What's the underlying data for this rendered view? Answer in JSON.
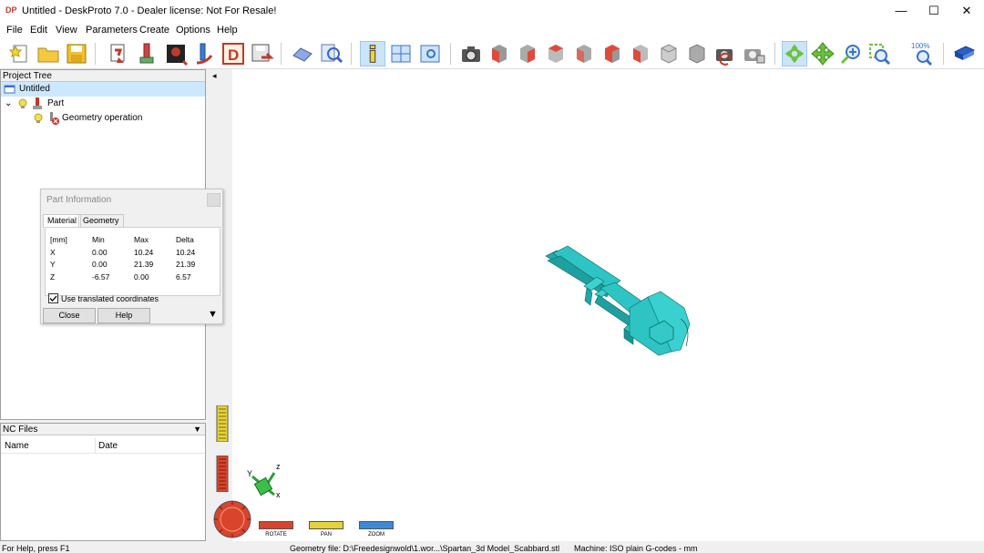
{
  "window": {
    "title": "Untitled - DeskProto 7.0 - Dealer license: Not For Resale!",
    "app_icon_text": "DP",
    "minimize": "—",
    "maximize": "☐",
    "close": "✕"
  },
  "menu": {
    "items": [
      "File",
      "Edit",
      "View",
      "Parameters",
      "Create",
      "Options",
      "Help"
    ]
  },
  "toolbar": {
    "zoom_label": "100%"
  },
  "project_tree": {
    "header": "Project Tree",
    "root": "Untitled",
    "part": "Part",
    "operation": "Geometry operation",
    "expander": "⌄"
  },
  "nc_files": {
    "header": "NC Files",
    "dropdown": "▼",
    "columns": [
      "Name",
      "Date"
    ]
  },
  "part_info": {
    "title": "Part Information",
    "tabs": [
      "Material",
      "Geometry"
    ],
    "headers": [
      "[mm]",
      "Min",
      "Max",
      "Delta"
    ],
    "rows": [
      [
        "X",
        "0.00",
        "10.24",
        "10.24"
      ],
      [
        "Y",
        "0.00",
        "21.39",
        "21.39"
      ],
      [
        "Z",
        "-6.57",
        "0.00",
        "6.57"
      ]
    ],
    "checkbox_label": "Use translated coordinates",
    "checkbox_checked": true,
    "close_button": "Close",
    "help_button": "Help",
    "more_arrow": "▼"
  },
  "viewport": {
    "collapse_arrow": "◂",
    "model_color": "#2ec4c4",
    "axis_labels": {
      "x": "x",
      "y": "Y",
      "z": "z"
    },
    "view_controls": [
      "ROTATE",
      "PAN",
      "ZOOM"
    ]
  },
  "statusbar": {
    "help_text": "For Help, press F1",
    "geometry_file": "Geometry file: D:\\Freedesignwold\\1.wor...\\Spartan_3d Model_Scabbard.stl",
    "machine": "Machine: ISO plain G-codes - mm"
  }
}
